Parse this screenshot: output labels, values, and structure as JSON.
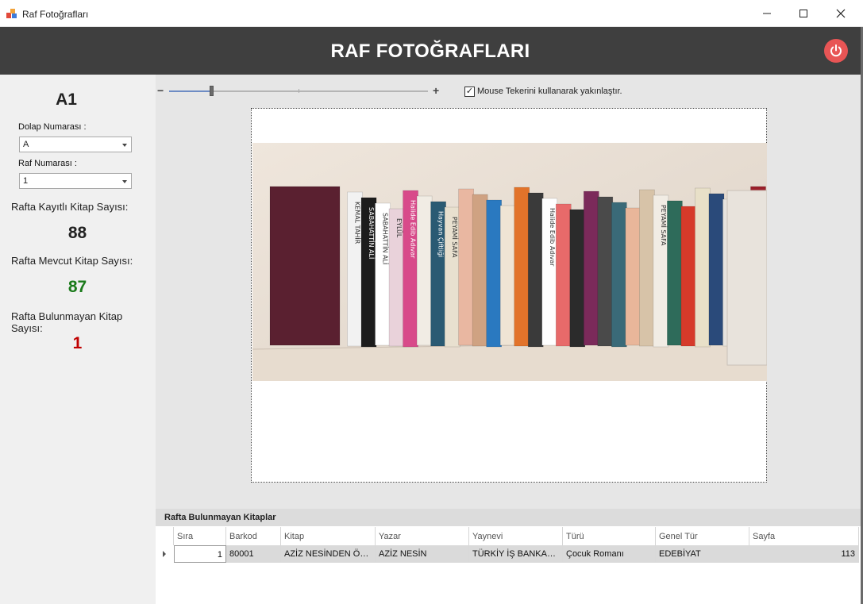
{
  "window": {
    "title": "Raf Fotoğrafları",
    "icon": "app-color-blocks-icon",
    "controls": [
      "minimize-icon",
      "maximize-icon",
      "close-icon"
    ]
  },
  "header": {
    "title": "RAF FOTOĞRAFLARI",
    "power_icon": "power-icon",
    "power_color": "#e85555",
    "background": "#3f3f3f"
  },
  "left": {
    "shelf_code": "A1",
    "cabinet_label": "Dolap Numarası :",
    "cabinet_value": "A",
    "shelf_label": "Raf Numarası :",
    "shelf_value": "1",
    "registered_label": "Rafta Kayıtlı Kitap Sayısı:",
    "registered_value": "88",
    "present_label": "Rafta Mevcut Kitap Sayısı:",
    "present_value": "87",
    "present_color": "#1a7a1a",
    "missing_label": "Rafta Bulunmayan Kitap Sayısı:",
    "missing_value": "1",
    "missing_color": "#c00000"
  },
  "viewer": {
    "zoom_minus": "−",
    "zoom_plus": "+",
    "zoom_level": 0.1,
    "mouse_wheel_checked": true,
    "mouse_wheel_label": "Mouse Tekerini kullanarak yakınlaştır.",
    "books": [
      {
        "color": "#5a2030",
        "title": ""
      },
      {
        "color": "#f2f2f2",
        "title": "KEMAL TAHİR"
      },
      {
        "color": "#1c1c1c",
        "title": "SABAHATTİN ALİ"
      },
      {
        "color": "#ffffff",
        "title": "SABAHATTİN ALİ"
      },
      {
        "color": "#e9d2da",
        "title": "EYLÜL"
      },
      {
        "color": "#d84a8a",
        "title": "Halide Edib Adıvar"
      },
      {
        "color": "#f1ece4",
        "title": ""
      },
      {
        "color": "#2a5a73",
        "title": "Hayvan Çiftliği"
      },
      {
        "color": "#e8e0cf",
        "title": "PEYAMİ SAFA"
      },
      {
        "color": "#e9b7a1",
        "title": ""
      },
      {
        "color": "#cfa282",
        "title": ""
      },
      {
        "color": "#2a79c0",
        "title": ""
      },
      {
        "color": "#efe4d4",
        "title": ""
      },
      {
        "color": "#e2732a",
        "title": ""
      },
      {
        "color": "#3a3a3a",
        "title": ""
      },
      {
        "color": "#ffffff",
        "title": "Halide Edib Adıvar"
      },
      {
        "color": "#e86a6a",
        "title": ""
      },
      {
        "color": "#2b2b2b",
        "title": ""
      },
      {
        "color": "#7b2a5a",
        "title": ""
      },
      {
        "color": "#4a4a4a",
        "title": ""
      },
      {
        "color": "#3a6a78",
        "title": ""
      },
      {
        "color": "#e9b69a",
        "title": ""
      },
      {
        "color": "#d7c3a8",
        "title": ""
      },
      {
        "color": "#f1ece4",
        "title": "PEYAMİ SAFA"
      },
      {
        "color": "#2e6b5a",
        "title": ""
      },
      {
        "color": "#d63a2a",
        "title": ""
      },
      {
        "color": "#e8e0c8",
        "title": ""
      },
      {
        "color": "#2a4a7a",
        "title": ""
      },
      {
        "color": "#e6e3de",
        "title": ""
      },
      {
        "color": "#c8242a",
        "title": ""
      },
      {
        "color": "#9a1f2a",
        "title": ""
      }
    ]
  },
  "grid": {
    "caption": "Rafta Bulunmayan Kitaplar",
    "columns": [
      "Sıra",
      "Barkod",
      "Kitap",
      "Yazar",
      "Yaynevi",
      "Türü",
      "Genel Tür",
      "Sayfa"
    ],
    "rows": [
      {
        "sira": "1",
        "barkod": "80001",
        "kitap": "AZİZ NESİNDEN ÖĞR...",
        "yazar": "AZİZ NESİN",
        "yayinevi": "TÜRKİY İŞ BANKASI ...",
        "tur": "Çocuk Romanı",
        "genel_tur": "EDEBİYAT",
        "sayfa": "113"
      }
    ]
  }
}
